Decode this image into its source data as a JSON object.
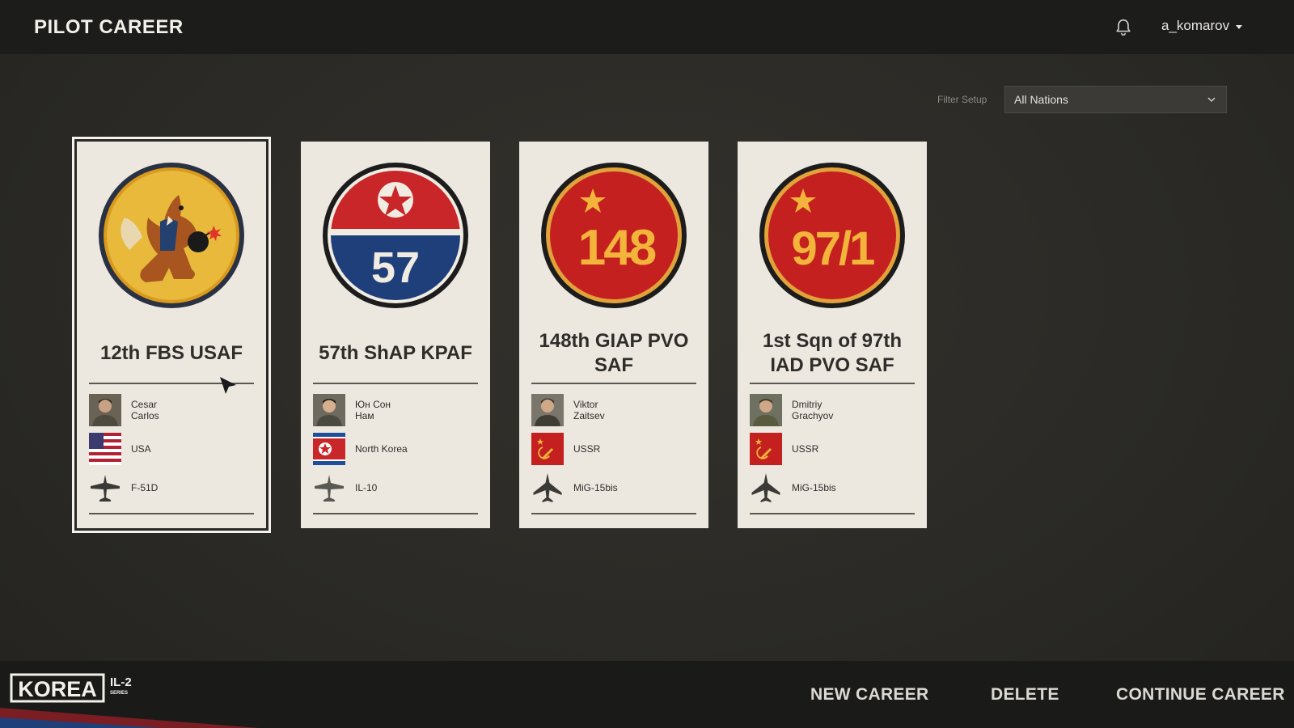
{
  "header": {
    "title": "PILOT CAREER",
    "username": "a_komarov"
  },
  "filter": {
    "label": "Filter Setup",
    "selected": "All Nations"
  },
  "cards": [
    {
      "name": "12th FBS USAF",
      "pilot": "Cesar\nCarlos",
      "nation": "USA",
      "aircraft": "F-51D",
      "selected": true,
      "emblem_colors": {
        "ring": "#1f2a3a",
        "fill": "#e6b530"
      }
    },
    {
      "name": "57th ShAP KPAF",
      "pilot": "Юн Сон\nНам",
      "nation": "North Korea",
      "aircraft": "IL-10",
      "emblem_text": "57",
      "emblem_colors": {
        "top": "#c9262a",
        "bottom": "#1f3f7a"
      }
    },
    {
      "name": "148th GIAP PVO SAF",
      "pilot": "Viktor\nZaitsev",
      "nation": "USSR",
      "aircraft": "MiG-15bis",
      "emblem_text": "148",
      "emblem_colors": {
        "fill": "#c4201f",
        "text": "#f2b43a"
      }
    },
    {
      "name": "1st Sqn of 97th IAD PVO SAF",
      "pilot": "Dmitriy\nGrachyov",
      "nation": "USSR",
      "aircraft": "MiG-15bis",
      "emblem_text": "97/1",
      "emblem_colors": {
        "fill": "#c4201f",
        "text": "#f2b43a"
      }
    }
  ],
  "footer": {
    "logo_text": "KOREA",
    "series_text": "IL-2",
    "series_sub": "SERIES",
    "buttons": [
      "NEW CAREER",
      "DELETE",
      "CONTINUE CAREER"
    ]
  }
}
